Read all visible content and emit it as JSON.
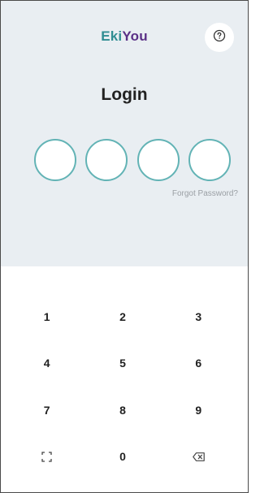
{
  "header": {
    "brand_part1": "Eki",
    "brand_part2": "You",
    "brand_color1": "#2f8d92",
    "brand_color2": "#5a2f86",
    "help_icon": "question-circle-icon"
  },
  "login": {
    "title": "Login",
    "pin_slots": 4,
    "forgot_label": "Forgot Password?"
  },
  "keypad": {
    "keys": [
      "1",
      "2",
      "3",
      "4",
      "5",
      "6",
      "7",
      "8",
      "9",
      "0"
    ],
    "left_icon": "scan-frame-icon",
    "right_icon": "backspace-icon"
  },
  "colors": {
    "top_background": "#e9eef2",
    "pin_border": "#62b3b5"
  }
}
